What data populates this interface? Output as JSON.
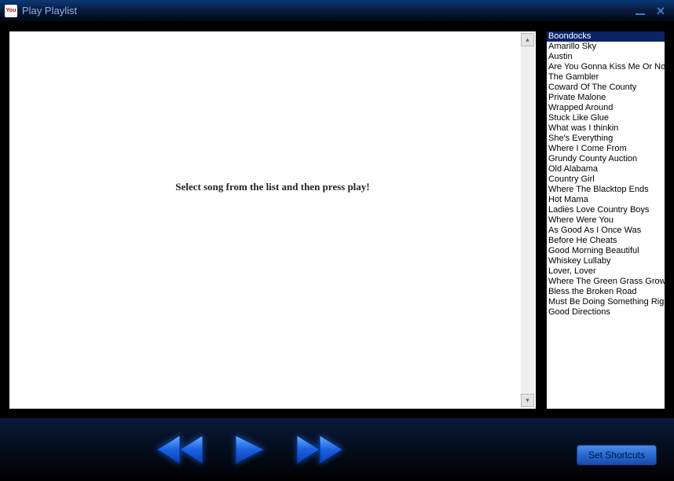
{
  "titlebar": {
    "title": "Play Playlist",
    "app_icon_text": "You"
  },
  "main": {
    "prompt": "Select song from the list and then press play!"
  },
  "playlist": {
    "selected_index": 0,
    "items": [
      "Boondocks",
      "Amarillo Sky",
      "Austin",
      "Are You Gonna Kiss Me Or Not",
      "The Gambler",
      "Coward Of The County",
      "Private Malone",
      "Wrapped Around",
      "Stuck Like Glue",
      "What was I thinkin",
      "She's Everything",
      "Where I Come From",
      "Grundy County Auction",
      "Old Alabama",
      "Country Girl",
      "Where The Blacktop Ends",
      "Hot Mama",
      "Ladies Love Country Boys",
      "Where Were You",
      "As Good As I Once Was",
      "Before He Cheats",
      "Good Morning Beautiful",
      "Whiskey Lullaby",
      "Lover, Lover",
      "Where The Green Grass Grows",
      "Bless the Broken Road",
      "Must Be Doing Something Right",
      "Good Directions"
    ]
  },
  "controls": {
    "set_shortcuts_label": "Set Shortcuts"
  },
  "colors": {
    "titlebar_text": "#8ab4e8",
    "selection_bg": "#0a246a",
    "button_blue": "#2a6ad0"
  }
}
